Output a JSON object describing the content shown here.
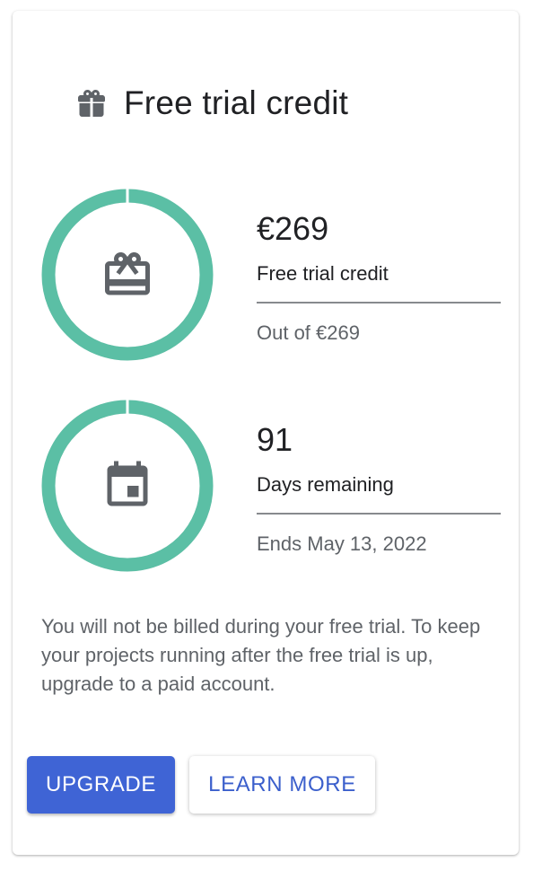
{
  "card": {
    "title": "Free trial credit",
    "header_icon": "gift-icon"
  },
  "credit": {
    "amount": "€269",
    "label": "Free trial credit",
    "sub": "Out of €269",
    "fraction_remaining": 1.0,
    "icon": "gift-card-icon"
  },
  "days": {
    "count": "91",
    "label": "Days remaining",
    "sub": "Ends May 13, 2022",
    "fraction_remaining": 1.0,
    "icon": "calendar-icon"
  },
  "notice": "You will not be billed during your free trial. To keep your projects running after the free trial is up, upgrade to a paid account.",
  "buttons": {
    "upgrade": "UPGRADE",
    "learn_more": "LEARN MORE"
  },
  "colors": {
    "ring": "#5bbfa5",
    "primary": "#3f64d5",
    "icon": "#5f6368"
  }
}
